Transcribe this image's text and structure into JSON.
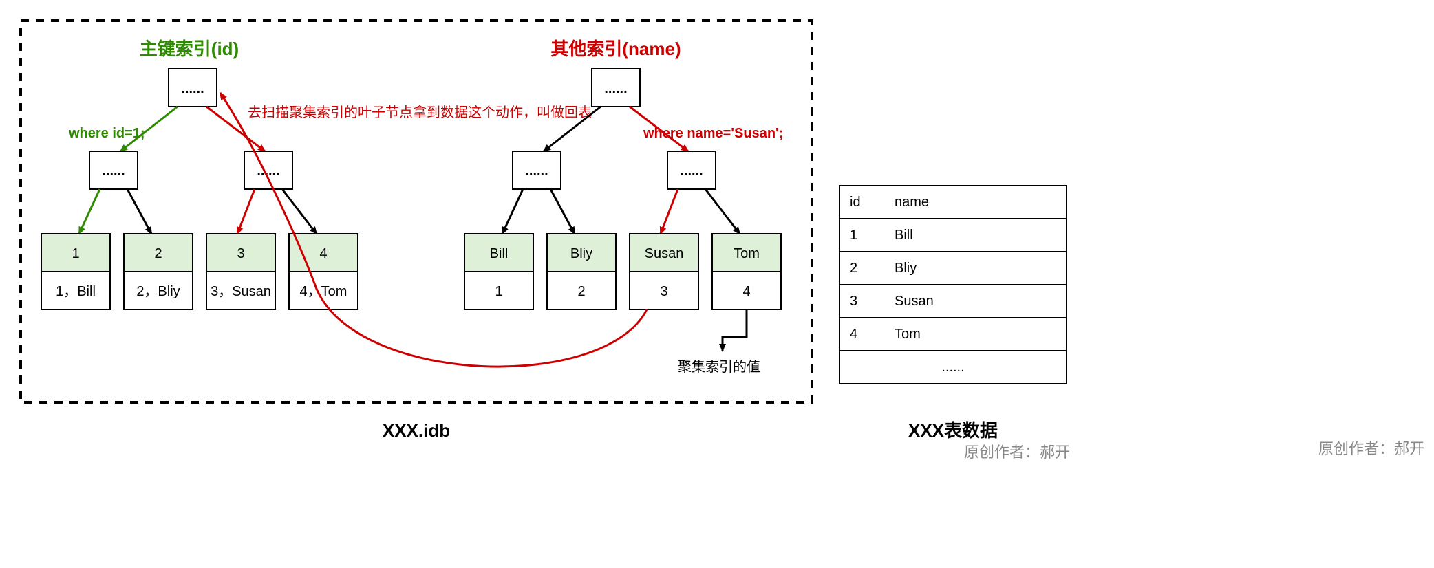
{
  "container_label": "XXX.idb",
  "left_index": {
    "title": "主键索引(id)",
    "where": "where id=1;",
    "root_label": "......",
    "mid_left": "......",
    "mid_right": "......",
    "leaves": [
      {
        "key": "1",
        "value": "1，Bill"
      },
      {
        "key": "2",
        "value": "2，Bliy"
      },
      {
        "key": "3",
        "value": "3，Susan"
      },
      {
        "key": "4",
        "value": "4，Tom"
      }
    ]
  },
  "right_index": {
    "title": "其他索引(name)",
    "where": "where name='Susan';",
    "root_label": "......",
    "mid_left": "......",
    "mid_right": "......",
    "leaves": [
      {
        "key": "Bill",
        "value": "1"
      },
      {
        "key": "Bliy",
        "value": "2"
      },
      {
        "key": "Susan",
        "value": "3"
      },
      {
        "key": "Tom",
        "value": "4"
      }
    ],
    "pointer_label": "聚集索引的值"
  },
  "callback_note": "去扫描聚集索引的叶子节点拿到数据这个动作，叫做回表",
  "table": {
    "caption": "XXX表数据",
    "headers": [
      "id",
      "name"
    ],
    "rows": [
      [
        "1",
        "Bill"
      ],
      [
        "2",
        "Bliy"
      ],
      [
        "3",
        "Susan"
      ],
      [
        "4",
        "Tom"
      ]
    ],
    "more": "......"
  },
  "credit": "原创作者：郝开"
}
